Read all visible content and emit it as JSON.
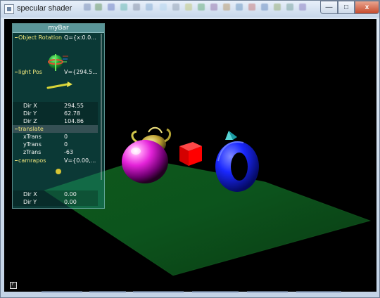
{
  "window": {
    "title": "specular shader",
    "buttons": {
      "minimize": "—",
      "maximize": "□",
      "close": "x"
    }
  },
  "panel": {
    "title": "myBar",
    "groups": {
      "object_rotation": {
        "label": "Object Rotation",
        "value": "Q={x:0.0..."
      },
      "light_pos": {
        "label": "light Pos",
        "value": "V={294.5..."
      },
      "translate": {
        "label": "translate"
      },
      "camrapos": {
        "label": "camrapos",
        "value": "V={0.00,..."
      }
    },
    "light_fields": [
      {
        "label": "Dir X",
        "value": "294.55"
      },
      {
        "label": "Dir Y",
        "value": "62.78"
      },
      {
        "label": "Dir Z",
        "value": "104.86"
      }
    ],
    "translate_fields": [
      {
        "label": "xTrans",
        "value": "0"
      },
      {
        "label": "yTrans",
        "value": "0"
      },
      {
        "label": "zTrans",
        "value": "-63"
      }
    ],
    "camera_fields": [
      {
        "label": "Dir X",
        "value": "0.00"
      },
      {
        "label": "Dir Y",
        "value": "0.00"
      }
    ]
  },
  "scene": {
    "objects": {
      "plane": "green plane",
      "sphere": "magenta sphere",
      "teapot": "yellow teapot",
      "cube": "red cube",
      "torus": "blue torus",
      "cone": "cyan cone"
    },
    "colors": {
      "plane": "#0f5a1f",
      "sphere": "#e024d6",
      "teapot": "#d7c84a",
      "cube": "#ff1a1a",
      "torus": "#1a28ff",
      "cone": "#2bd3d3"
    }
  }
}
